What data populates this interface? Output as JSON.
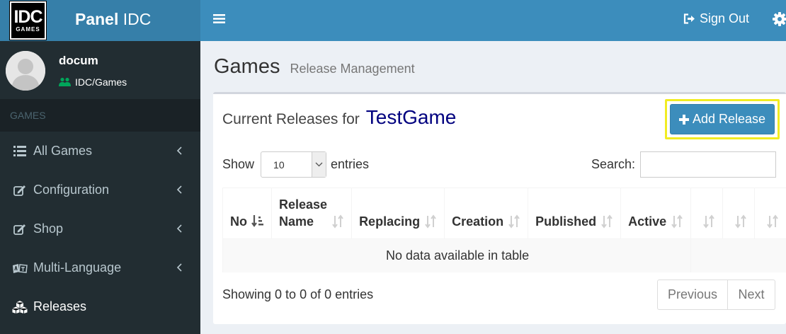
{
  "brand": {
    "logo_big": "IDC",
    "logo_small": "GAMES",
    "title_bold": "Panel",
    "title_rest": " IDC"
  },
  "user": {
    "name": "docum",
    "group": "IDC/Games"
  },
  "sidebar": {
    "section": "GAMES",
    "items": [
      {
        "label": "All Games",
        "icon": "list-icon"
      },
      {
        "label": "Configuration",
        "icon": "edit-icon"
      },
      {
        "label": "Shop",
        "icon": "edit-icon"
      },
      {
        "label": "Multi-Language",
        "icon": "language-icon"
      },
      {
        "label": "Releases",
        "icon": "cubes-icon"
      }
    ]
  },
  "topbar": {
    "signout_label": "Sign Out"
  },
  "page": {
    "title": "Games",
    "subtitle": "Release Management"
  },
  "box": {
    "title_prefix": "Current Releases for",
    "game_name": "TestGame",
    "add_button": "Add Release"
  },
  "table_controls": {
    "show_label": "Show",
    "page_size": "10",
    "entries_label": "entries",
    "search_label": "Search:",
    "search_value": ""
  },
  "table": {
    "columns": [
      {
        "line1": "No",
        "line2": ""
      },
      {
        "line1": "Release",
        "line2": "Name"
      },
      {
        "line1": "Replacing",
        "line2": ""
      },
      {
        "line1": "Creation",
        "line2": ""
      },
      {
        "line1": "Published",
        "line2": ""
      },
      {
        "line1": "Active",
        "line2": ""
      },
      {
        "line1": "",
        "line2": ""
      },
      {
        "line1": "",
        "line2": ""
      },
      {
        "line1": "",
        "line2": ""
      }
    ],
    "empty_message": "No data available in table"
  },
  "footer": {
    "info": "Showing 0 to 0 of 0 entries",
    "prev_label": "Previous",
    "next_label": "Next"
  },
  "colors": {
    "header_blue": "#3c8dbc",
    "logo_blue": "#367fa9",
    "sidebar_dark": "#222d32",
    "game_name": "#00007f",
    "highlight": "#f1ec22",
    "online_green": "#00a65a"
  }
}
